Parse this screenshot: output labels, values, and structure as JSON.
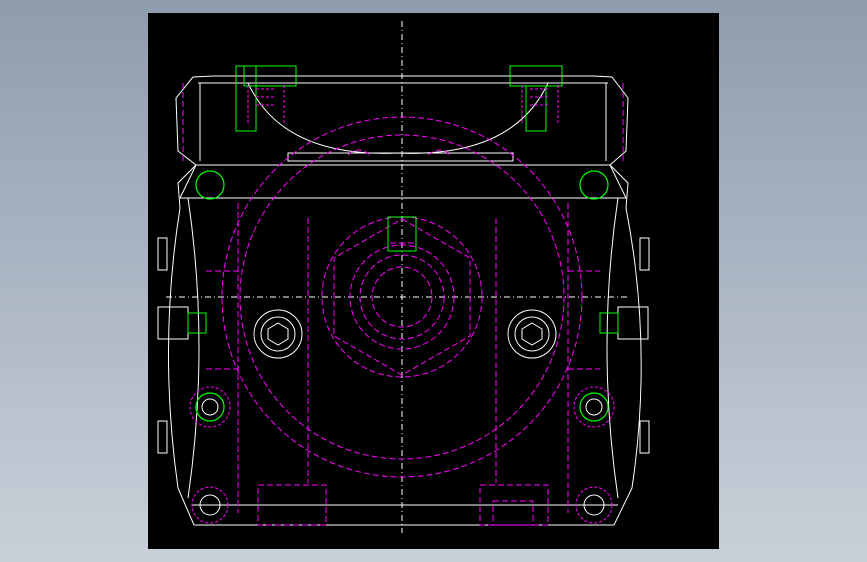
{
  "drawing": {
    "colors": {
      "background": "#000000",
      "outline": "#ffffff",
      "hidden": "#ff00ff",
      "fastener": "#00ff00",
      "centerline": "#ffffff"
    }
  }
}
